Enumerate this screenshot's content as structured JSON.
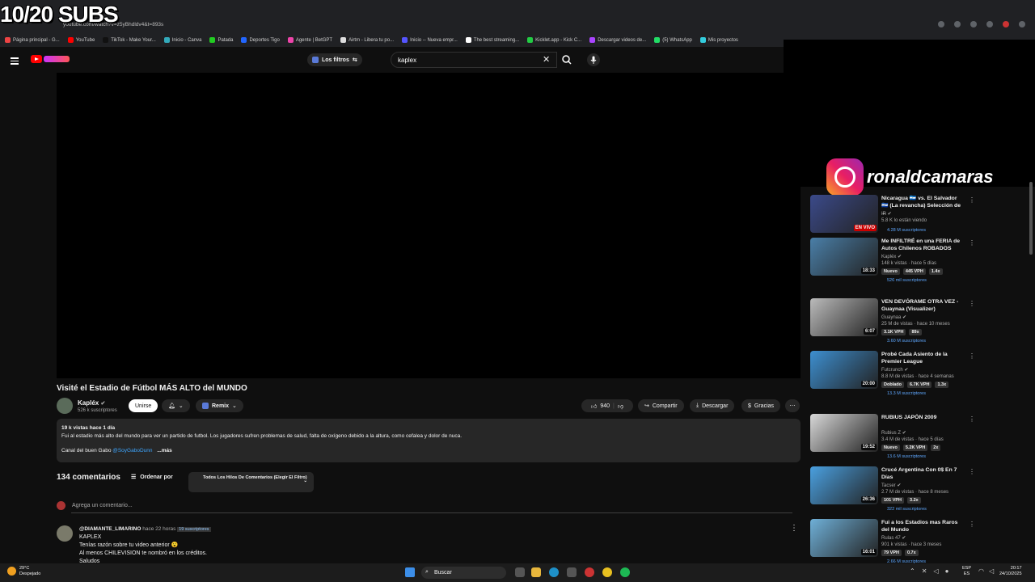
{
  "overlay": {
    "subs_goal": "10/20 SUBS"
  },
  "browser": {
    "url": "youtube.com/watch?v=z5yBhdldv4&t=893s",
    "bookmarks": [
      {
        "label": "Página principal - G...",
        "color": "#e44"
      },
      {
        "label": "YouTube",
        "color": "#f00"
      },
      {
        "label": "TikTok - Make Your...",
        "color": "#111"
      },
      {
        "label": "Inicio - Canva",
        "color": "#3ab"
      },
      {
        "label": "Patada",
        "color": "#2c2"
      },
      {
        "label": "Deportes Tigo",
        "color": "#26f"
      },
      {
        "label": "Agente | BetGPT",
        "color": "#e4a"
      },
      {
        "label": "Airtm - Libera tu po...",
        "color": "#ddd"
      },
      {
        "label": "Inicio -- Nueva empr...",
        "color": "#55f"
      },
      {
        "label": "The best streaming...",
        "color": "#fff"
      },
      {
        "label": "Kicklet.app - Kick C...",
        "color": "#2c4"
      },
      {
        "label": "Descargar videos de...",
        "color": "#a4f"
      },
      {
        "label": "(5) WhatsApp",
        "color": "#2d6"
      },
      {
        "label": "Mis proyectos",
        "color": "#3cd"
      }
    ]
  },
  "header": {
    "filters_label": "Los filtros",
    "search_value": "kaplex"
  },
  "video": {
    "title": "Visité el Estadio de Fútbol MÁS ALTO del MUNDO",
    "channel": "Kapléx",
    "subscribers": "526 k suscriptores",
    "join_label": "Unirse",
    "remix_label": "Remix",
    "likes": "940",
    "share_label": "Compartir",
    "download_label": "Descargar",
    "thanks_label": "Gracias"
  },
  "description": {
    "meta": "19 k vistas  hace 1 día",
    "text": "Fui al estadio más alto del mundo para ver un partido de futbol. Los jugadores sufren problemas de salud, falta de oxígeno debido a la altura, como cefalea y dolor de nuca.",
    "channel_line": "Canal del buen Gabo",
    "channel_handle": "@SoyGaboDunn",
    "more": "...más"
  },
  "comments": {
    "count": "134 comentarios",
    "sort_label": "Ordenar por",
    "thread_filter": "Todos Los Hilos De Comentarios (Elegir El Filtro)",
    "add_placeholder": "Agrega un comentario...",
    "first": {
      "author": "@DIAMANTE_LIMARINO",
      "time": "hace 22 horas",
      "badge": "19 suscriptores",
      "lines": [
        "KAPLEX",
        "Tenías razón sobre tu video anterior 😮",
        "Al menos CHILEVISION te nombró en los créditos.",
        "Saludos"
      ]
    }
  },
  "instagram": {
    "handle": "ronaldcamaras"
  },
  "sidebar": [
    {
      "title": "Nicaragua 🇳🇮 vs. El Salvador 🇸🇻 (La revancha) Selección de ...",
      "channel": "IR",
      "meta": "5.8 K lo están viendo",
      "badges": [],
      "subs": "4.28 M suscriptores",
      "duration": "EN VIVO",
      "thumb": "#3b4a8a"
    },
    {
      "title": "Me INFILTRÉ en una FERIA de Autos Chilenos ROBADOS",
      "channel": "Kapléx",
      "meta": "148 k vistas · hace 5 días",
      "badges": [
        "Nuevo",
        "445 VPH",
        "1.4x"
      ],
      "subs": "526 mil suscriptores",
      "duration": "18:33",
      "thumb": "#4a7fa8"
    },
    {
      "title": "VEN DEVÓRAME OTRA VEZ - Guaynaa (Visualizer)",
      "channel": "Guaynaa",
      "meta": "25 M de vistas · hace 10 meses",
      "badges": [
        "3.1K VPH",
        "89x"
      ],
      "subs": "3.60 M suscriptores",
      "duration": "6:07",
      "thumb": "#bbbbbb"
    },
    {
      "title": "Probé Cada Asiento de la Premier League",
      "channel": "Futcrunch",
      "meta": "8.8 M de vistas · hace 4 semanas",
      "badges": [
        "Doblado",
        "6.7K VPH",
        "1.3x"
      ],
      "subs": "13.3 M suscriptores",
      "duration": "20:00",
      "thumb": "#3d8fd0"
    },
    {
      "title": "RUBIUS JAPÓN 2009",
      "channel": "Rubius Z",
      "meta": "3.4 M de vistas · hace 5 días",
      "badges": [
        "Nuevo",
        "5.2K VPH",
        "2x"
      ],
      "subs": "13.6 M suscriptores",
      "duration": "19:52",
      "thumb": "#d8d8d8"
    },
    {
      "title": "Crucé Argentina Con 0$ En 7 Días",
      "channel": "Tacser",
      "meta": "2.7 M de vistas · hace 8 meses",
      "badges": [
        "101 VPH",
        "3.2x"
      ],
      "subs": "322 mil suscriptores",
      "duration": "26:36",
      "thumb": "#4aa0e0"
    },
    {
      "title": "Fui a los Estadios mas Raros del Mundo",
      "channel": "Rulas 47",
      "meta": "901 k vistas · hace 3 meses",
      "badges": [
        "79 VPH",
        "0.7x"
      ],
      "subs": "2.66 M suscriptores",
      "duration": "16:01",
      "thumb": "#6fb0d8"
    }
  ],
  "taskbar": {
    "temp": "29°C",
    "weather": "Despejado",
    "search_label": "Buscar",
    "lang": "ESP",
    "lang2": "ES",
    "time": "20:17",
    "date": "24/10/2025"
  }
}
